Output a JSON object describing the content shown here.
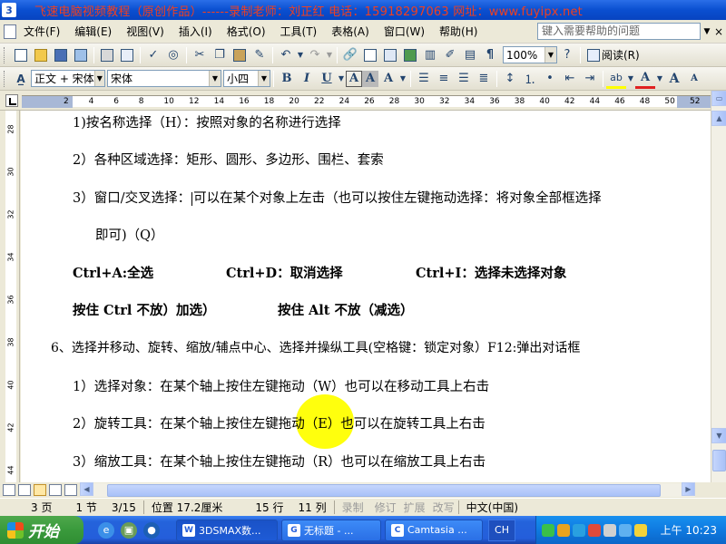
{
  "window": {
    "app_icon_label": "3",
    "title": "飞速电脑视频教程（原创作品）------录制老师：刘正红    电话：15918297063    网址：www.fuyipx.net"
  },
  "menu": {
    "items": [
      "文件(F)",
      "编辑(E)",
      "视图(V)",
      "插入(I)",
      "格式(O)",
      "工具(T)",
      "表格(A)",
      "窗口(W)",
      "帮助(H)"
    ],
    "help_placeholder": "键入需要帮助的问题",
    "close_glyph": "×"
  },
  "toolbar": {
    "zoom": "100%",
    "read_label": "阅读(R)",
    "style_box": "正文 + 宋体",
    "font_box": "宋体",
    "size_box": "小四"
  },
  "ruler": {
    "numbers": [
      "2",
      "4",
      "6",
      "8",
      "10",
      "12",
      "14",
      "16",
      "18",
      "20",
      "22",
      "24",
      "26",
      "28",
      "30",
      "32",
      "34",
      "36",
      "38",
      "40",
      "42",
      "44",
      "46",
      "48",
      "50",
      "52"
    ],
    "vertical_numbers": [
      "28",
      "30",
      "32",
      "34",
      "36",
      "38",
      "40",
      "42",
      "44"
    ]
  },
  "document": {
    "l1": "1)按名称选择（H）：按照对象的名称进行选择",
    "l2": "2）各种区域选择：矩形、圆形、多边形、围栏、套索",
    "l3a": "3）窗口/交叉选择：",
    "l3b": "可以在某个对象上左击（也可以按住左键拖动选择：将对象全部框选择",
    "l4": "即可)（Q）",
    "l5a": "Ctrl+A:全选",
    "l5b": "Ctrl+D：取消选择",
    "l5c": "Ctrl+I：选择未选择对象",
    "l6a": "按住 Ctrl 不放）加选）",
    "l6b": "按住 Alt 不放（减选）",
    "l7": "6、选择并移动、旋转、缩放/辅点中心、选择并操纵工具(空格键：锁定对象）F12:弹出对话框",
    "l8": "1）选择对象：在某个轴上按住左键拖动（W）也可以在移动工具上右击",
    "l9": "2）旋转工具：在某个轴上按住左键拖动（E）也可以在旋转工具上右击",
    "l10": "3）缩放工具：在某个轴上按住左键拖动（R）也可以在缩放工具上右击"
  },
  "status": {
    "page": "3 页",
    "section": "1 节",
    "pages": "3/15",
    "position": "位置 17.2厘米",
    "line": "15 行",
    "column": "11 列",
    "rec": "录制",
    "trk": "修订",
    "ext": "扩展",
    "ovr": "改写",
    "language": "中文(中国)"
  },
  "taskbar": {
    "start": "开始",
    "tasks": [
      "3DSMAX数...",
      "无标题 - ...",
      "Camtasia ..."
    ],
    "lang": "CH",
    "clock": "上午 10:23"
  }
}
